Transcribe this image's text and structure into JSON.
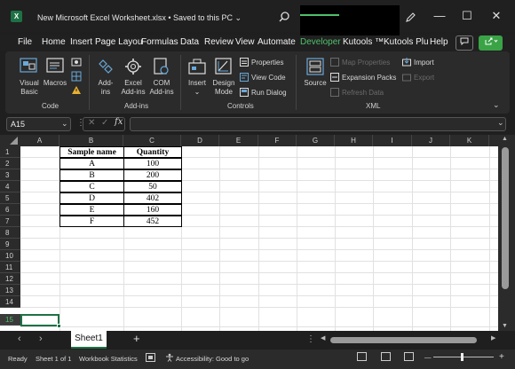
{
  "titlebar": {
    "app_icon": "X",
    "title": "New Microsoft Excel Worksheet.xlsx • Saved to this PC ⌄",
    "minimize": "—",
    "restore": "☐",
    "close": "✕"
  },
  "tabs": [
    "File",
    "Home",
    "Insert",
    "Page Layou",
    "Formulas",
    "Data",
    "Review",
    "View",
    "Automate",
    "Developer",
    "Kutools ™",
    "Kutools Plu",
    "Help"
  ],
  "active_tab": "Developer",
  "ribbon": {
    "code": {
      "label": "Code",
      "visual_basic": [
        "Visual",
        "Basic"
      ],
      "macros": "Macros"
    },
    "addins": {
      "label": "Add-ins",
      "addins": [
        "Add-",
        "ins"
      ],
      "excel_addins": [
        "Excel",
        "Add-ins"
      ],
      "com_addins": [
        "COM",
        "Add-ins"
      ]
    },
    "controls": {
      "label": "Controls",
      "insert": "Insert",
      "insert_chev": "⌄",
      "design_mode": [
        "Design",
        "Mode"
      ],
      "properties": "Properties",
      "view_code": "View Code",
      "run_dialog": "Run Dialog"
    },
    "xml": {
      "label": "XML",
      "source": "Source",
      "map_properties": "Map Properties",
      "expansion_packs": "Expansion Packs",
      "refresh_data": "Refresh Data",
      "import": "Import",
      "export": "Export"
    },
    "collapse_icon": "⌄"
  },
  "formula_bar": {
    "name_box": "A15",
    "name_chev": "⌄",
    "dots": "⋮",
    "cancel": "✕",
    "enter": "✓",
    "fx": "fx",
    "expand": "⌄"
  },
  "columns": [
    "A",
    "B",
    "C",
    "D",
    "E",
    "F",
    "G",
    "H",
    "I",
    "J",
    "K"
  ],
  "rows": [
    "1",
    "2",
    "3",
    "4",
    "5",
    "6",
    "7",
    "8",
    "9",
    "10",
    "11",
    "12",
    "13",
    "14",
    "15"
  ],
  "selected_row": "15",
  "table": {
    "header": [
      "Sample name",
      "Quantity"
    ],
    "rows": [
      [
        "A",
        "100"
      ],
      [
        "B",
        "200"
      ],
      [
        "C",
        "50"
      ],
      [
        "D",
        "402"
      ],
      [
        "E",
        "160"
      ],
      [
        "F",
        "452"
      ]
    ]
  },
  "sheetbar": {
    "prev": "‹",
    "next": "›",
    "sheet": "Sheet1",
    "add": "+",
    "dots": "⋮"
  },
  "status": {
    "ready": "Ready",
    "sheet_of": "Sheet 1 of 1",
    "workbook_stats": "Workbook Statistics",
    "accessibility": "Accessibility: Good to go",
    "zoom_minus": "—",
    "zoom_plus": "+"
  },
  "colors": {
    "accent": "#4fc06a",
    "excel_green": "#1e7145"
  }
}
